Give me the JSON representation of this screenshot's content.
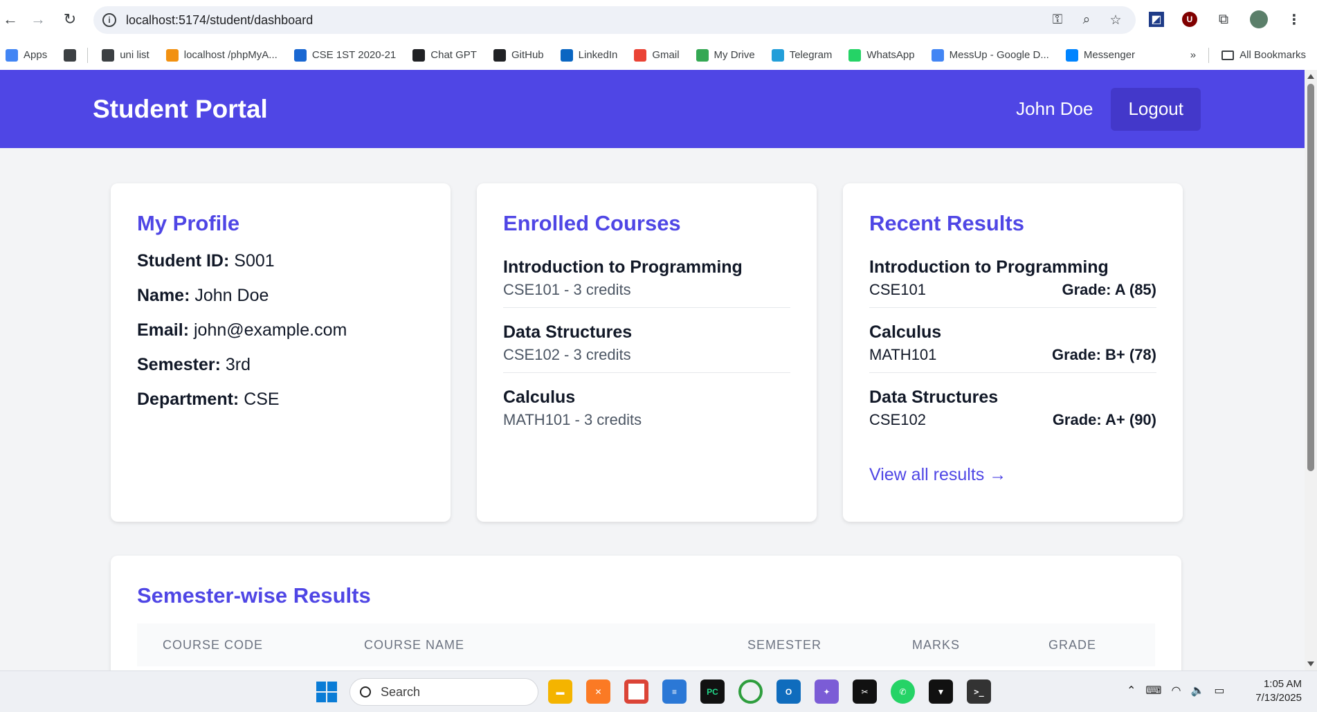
{
  "browser": {
    "url": "localhost:5174/student/dashboard",
    "bookmarks": [
      {
        "label": "Apps",
        "icon": "apps-grid-icon",
        "color": "#4285f4"
      },
      {
        "label": "",
        "icon": "tab-groups-icon",
        "color": "#3c4043"
      },
      {
        "label": "uni list",
        "icon": "folder-icon",
        "color": "#3c4043"
      },
      {
        "label": "localhost /phpMyA...",
        "icon": "phpmyadmin-icon",
        "color": "#f29111"
      },
      {
        "label": "CSE 1ST 2020-21",
        "icon": "classroom-icon",
        "color": "#1967d2"
      },
      {
        "label": "Chat GPT",
        "icon": "chatgpt-icon",
        "color": "#202124"
      },
      {
        "label": "GitHub",
        "icon": "github-icon",
        "color": "#202124"
      },
      {
        "label": "LinkedIn",
        "icon": "linkedin-icon",
        "color": "#0a66c2"
      },
      {
        "label": "Gmail",
        "icon": "gmail-icon",
        "color": "#ea4335"
      },
      {
        "label": "My Drive",
        "icon": "drive-icon",
        "color": "#34a853"
      },
      {
        "label": "Telegram",
        "icon": "telegram-icon",
        "color": "#229ed9"
      },
      {
        "label": "WhatsApp",
        "icon": "whatsapp-icon",
        "color": "#25d366"
      },
      {
        "label": "MessUp - Google D...",
        "icon": "docs-icon",
        "color": "#4285f4"
      },
      {
        "label": "Messenger",
        "icon": "messenger-icon",
        "color": "#0084ff"
      }
    ],
    "more_bookmarks": "»",
    "all_bookmarks": "All Bookmarks"
  },
  "header": {
    "title": "Student Portal",
    "user_name": "John Doe",
    "logout_label": "Logout",
    "accent_color": "#4f46e5"
  },
  "profile": {
    "title": "My Profile",
    "fields": [
      {
        "label": "Student ID:",
        "value": "S001"
      },
      {
        "label": "Name:",
        "value": "John Doe"
      },
      {
        "label": "Email:",
        "value": "john@example.com"
      },
      {
        "label": "Semester:",
        "value": "3rd"
      },
      {
        "label": "Department:",
        "value": "CSE"
      }
    ]
  },
  "courses": {
    "title": "Enrolled Courses",
    "items": [
      {
        "name": "Introduction to Programming",
        "meta": "CSE101 - 3 credits"
      },
      {
        "name": "Data Structures",
        "meta": "CSE102 - 3 credits"
      },
      {
        "name": "Calculus",
        "meta": "MATH101 - 3 credits"
      }
    ]
  },
  "results": {
    "title": "Recent Results",
    "items": [
      {
        "name": "Introduction to Programming",
        "code": "CSE101",
        "grade": "Grade: A (85)"
      },
      {
        "name": "Calculus",
        "code": "MATH101",
        "grade": "Grade: B+ (78)"
      },
      {
        "name": "Data Structures",
        "code": "CSE102",
        "grade": "Grade: A+ (90)"
      }
    ],
    "view_all": "View all results →"
  },
  "semester_results": {
    "title": "Semester-wise Results",
    "columns": [
      "COURSE CODE",
      "COURSE NAME",
      "SEMESTER",
      "MARKS",
      "GRADE"
    ]
  },
  "taskbar": {
    "search_placeholder": "Search",
    "time": "1:05 AM",
    "date": "7/13/2025"
  }
}
